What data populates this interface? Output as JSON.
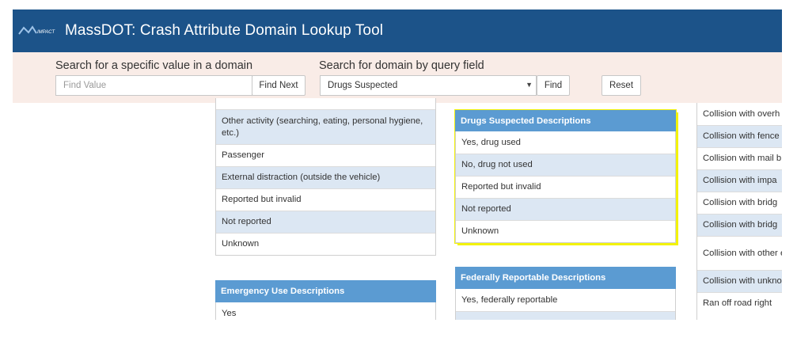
{
  "header": {
    "title": "MassDOT: Crash Attribute Domain Lookup Tool",
    "logo_text": "IMPACT",
    "bar_color": "#1c5389"
  },
  "search": {
    "value_label": "Search for a specific value in a domain",
    "value_placeholder": "Find Value",
    "find_next_label": "Find Next",
    "domain_label": "Search for domain by query field",
    "domain_selected": "Drugs Suspected",
    "find_label": "Find",
    "reset_label": "Reset"
  },
  "left_column": {
    "rows": [
      "Other activity (searching, eating, personal hygiene, etc.)",
      "Passenger",
      "External distraction (outside the vehicle)",
      "Reported but invalid",
      "Not reported",
      "Unknown"
    ],
    "next_header": "Emergency Use Descriptions",
    "next_first_row": "Yes"
  },
  "middle_column": {
    "drugs_header": "Drugs Suspected Descriptions",
    "drugs_rows": [
      "Yes, drug used",
      "No, drug not used",
      "Reported but invalid",
      "Not reported",
      "Unknown"
    ],
    "federal_header": "Federally Reportable Descriptions",
    "federal_rows": [
      "Yes, federally reportable"
    ],
    "header_color": "#5b9bd2",
    "highlight_color": "#f3f30a"
  },
  "right_column": {
    "rows": [
      "Collision with overh",
      "Collision with fence",
      "Collision with mail b",
      "Collision with impa",
      "Collision with bridg",
      "Collision with bridg",
      "Collision with other etc.)",
      "Collision with unkno",
      "Ran off road right"
    ]
  }
}
